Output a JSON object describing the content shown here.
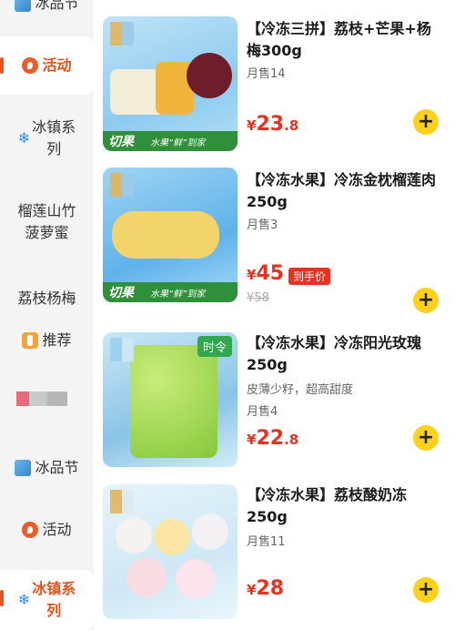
{
  "sidebar": {
    "items": [
      {
        "label": "冰品节",
        "icon": "ice-cube-icon"
      },
      {
        "label": "活动",
        "icon": "activity-icon",
        "active": true
      },
      {
        "label": "冰镇系\n列",
        "icon": "snowflake-icon"
      },
      {
        "label": "榴莲山竹\n菠萝蜜"
      },
      {
        "label": "荔枝杨梅",
        "icon": ""
      },
      {
        "label": "推荐",
        "icon": "recommend-icon"
      },
      {
        "label": "",
        "icon": "blurred-icon"
      },
      {
        "label": "冰品节",
        "icon": "ice-cube-icon"
      },
      {
        "label": "活动",
        "icon": "activity-icon"
      },
      {
        "label": "冰镇系\n列",
        "icon": "snowflake-icon",
        "active": true
      }
    ],
    "snowflake": "❄"
  },
  "products": [
    {
      "title": "【冷冻三拼】荔枝+芒果+杨梅300g",
      "sales": "月售14",
      "price_currency": "¥",
      "price_int": "23",
      "price_dec": ".8",
      "image_tag": "切果",
      "image_slogan": "水果“鲜”到家",
      "add_label": "+"
    },
    {
      "title": "【冷冻水果】冷冻金枕榴莲肉250g",
      "sales": "月售3",
      "price_currency": "¥",
      "price_int": "45",
      "price_dec": "",
      "price_badge": "到手价",
      "original_price": "¥58",
      "image_tag": "切果",
      "image_slogan": "水果“鲜”到家",
      "add_label": "+"
    },
    {
      "title": "【冷冻水果】冷冻阳光玫瑰250g",
      "desc": "皮薄少籽，超高甜度",
      "sales": "月售4",
      "price_currency": "¥",
      "price_int": "22",
      "price_dec": ".8",
      "image_tag": "时令",
      "add_label": "+"
    },
    {
      "title": "【冷冻水果】荔枝酸奶冻250g",
      "sales": "月售11",
      "price_currency": "¥",
      "price_int": "28",
      "price_dec": "",
      "add_label": "+"
    }
  ],
  "colors": {
    "accent": "#e8531d",
    "price": "#e8321f",
    "add_button": "#ffd11a",
    "sidebar_bg": "#f4f4f4"
  }
}
